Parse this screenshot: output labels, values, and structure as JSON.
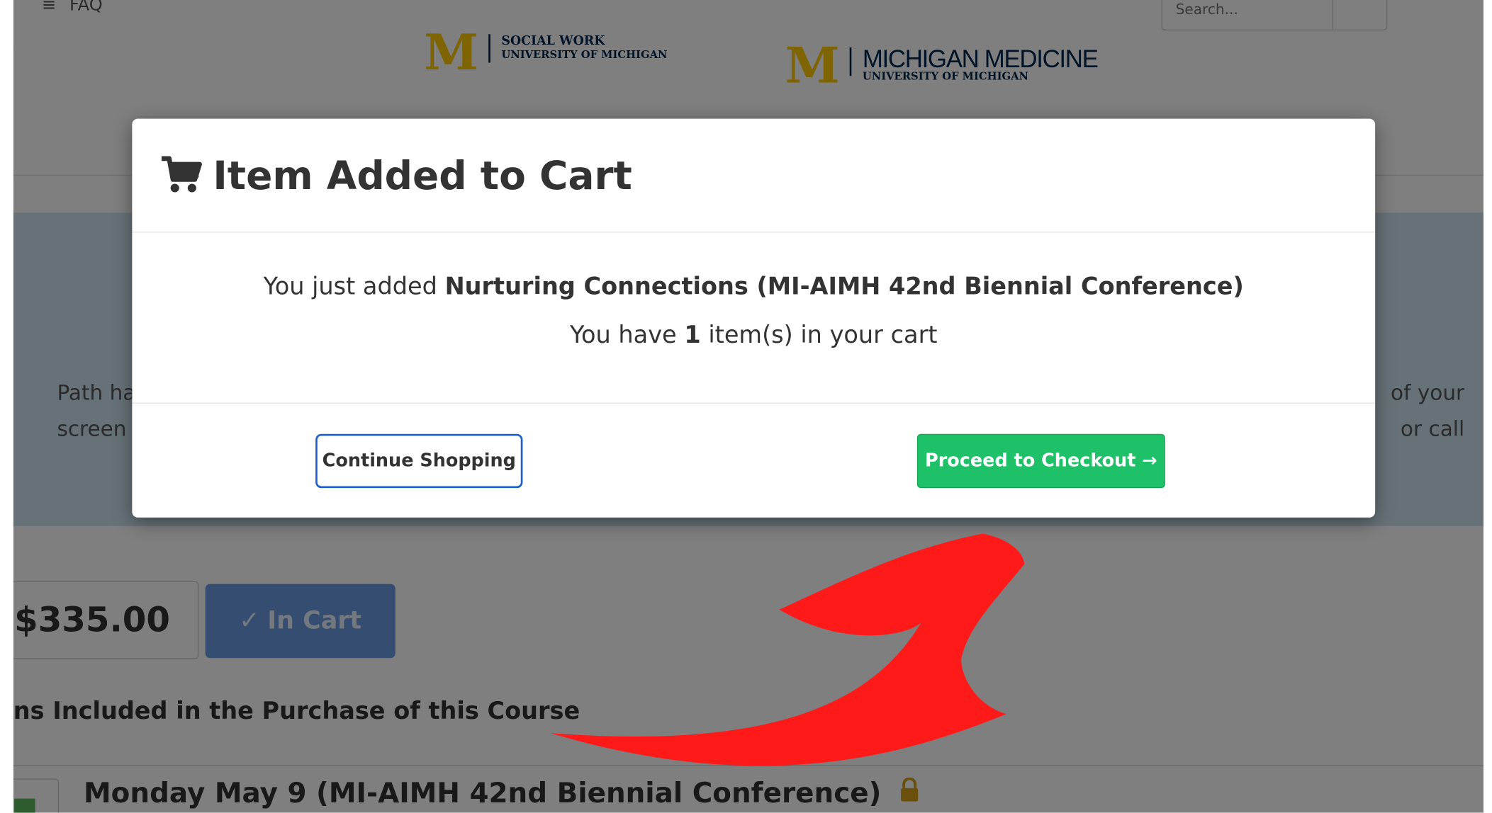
{
  "nav": {
    "menu_label": "FAQ",
    "search_placeholder": "Search..."
  },
  "logos": [
    {
      "m": "M",
      "line1": "SOCIAL WORK",
      "line2": "UNIVERSITY OF MICHIGAN"
    },
    {
      "m": "M",
      "line1": "MICHIGAN MEDICINE",
      "line2": "UNIVERSITY OF MICHIGAN"
    }
  ],
  "banner": {
    "left_line1": "Path ha",
    "left_line2": "screen",
    "right_line1": "of your",
    "right_line2": "or call"
  },
  "course": {
    "price": "$335.00",
    "in_cart_label": "In Cart",
    "included_heading": "ns Included in the Purchase of this Course",
    "session_title": "Monday May 9 (MI-AIMH 42nd Biennial Conference)"
  },
  "modal": {
    "title": "Item Added to Cart",
    "added_prefix": "You just added",
    "product_name": "Nurturing Connections (MI-AIMH 42nd Biennial Conference)",
    "count_prefix": "You have",
    "count": "1",
    "count_suffix": "item(s) in your cart",
    "continue_label": "Continue Shopping",
    "checkout_label": "Proceed to Checkout →"
  },
  "colors": {
    "checkout_green": "#1ec168",
    "continue_border": "#1a5fd0",
    "arrow_red": "#ff1a1a",
    "michigan_maize": "#FFCB05",
    "michigan_blue": "#00274C"
  },
  "icons": [
    "cart-icon",
    "check-icon",
    "lock-icon",
    "arrow-right-icon",
    "search-icon",
    "menu-icon"
  ]
}
